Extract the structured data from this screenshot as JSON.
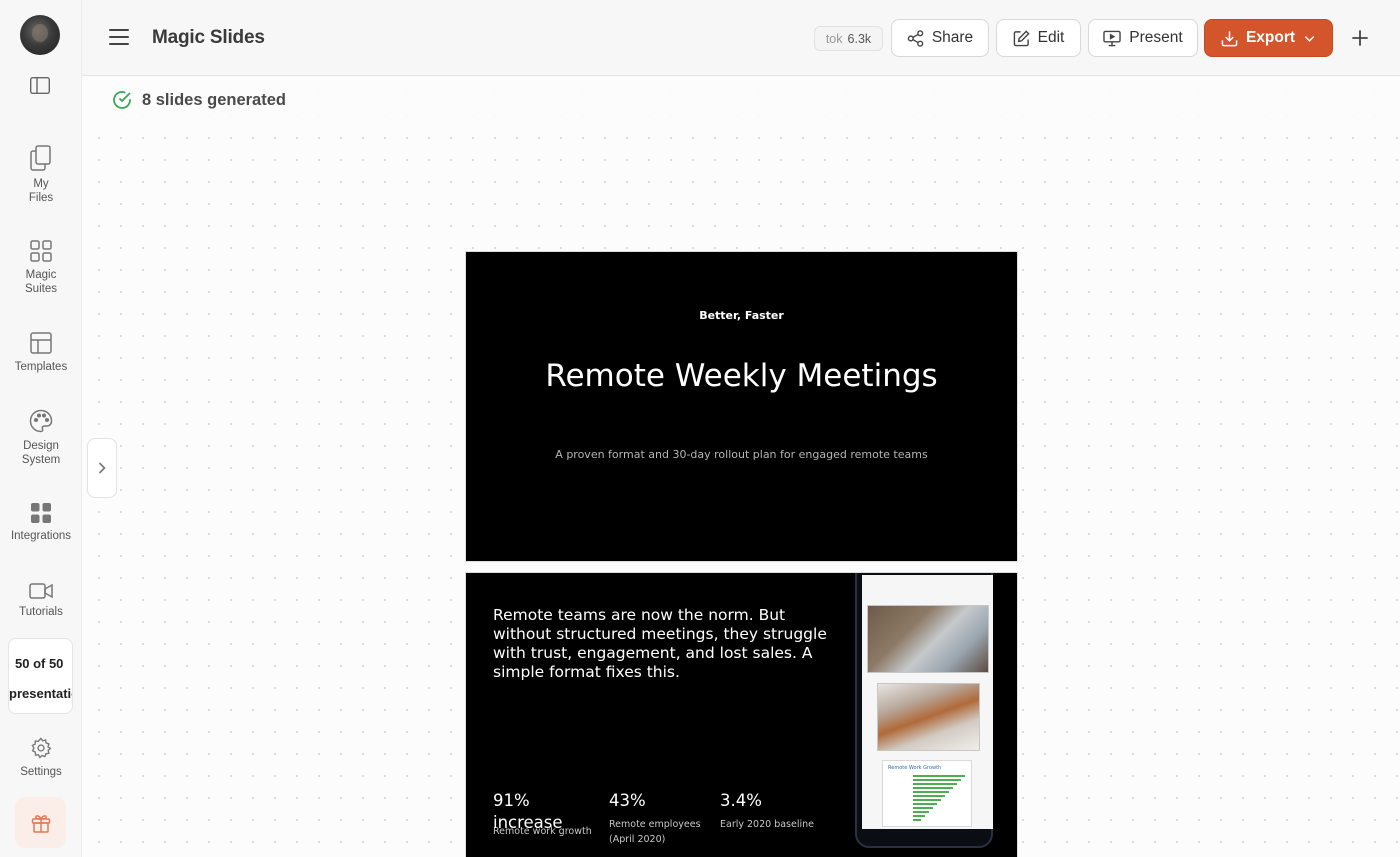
{
  "app": {
    "title": "Magic Slides"
  },
  "sidebar": {
    "items": [
      {
        "label_line1": "My",
        "label_line2": "Files",
        "icon": "files-icon"
      },
      {
        "label_line1": "Magic",
        "label_line2": "Suites",
        "icon": "grid-icon"
      },
      {
        "label_line1": "Templates",
        "label_line2": "",
        "icon": "template-icon"
      },
      {
        "label_line1": "Design",
        "label_line2": "System",
        "icon": "palette-icon"
      },
      {
        "label_line1": "Integrations",
        "label_line2": "",
        "icon": "integrations-icon"
      },
      {
        "label_line1": "Tutorials",
        "label_line2": "",
        "icon": "video-icon"
      },
      {
        "label_line1": "Settings",
        "label_line2": "",
        "icon": "gear-icon"
      }
    ],
    "quota": {
      "count": "50 of 50",
      "unit": "presentations"
    }
  },
  "header": {
    "tok_label": "tok",
    "tok_value": "6.3k",
    "share_label": "Share",
    "edit_label": "Edit",
    "present_label": "Present",
    "export_label": "Export",
    "accent_color": "#d4552c"
  },
  "status": {
    "text": "8 slides generated",
    "color": "#3aa65a"
  },
  "slides": [
    {
      "kicker": "Better, Faster",
      "title": "Remote Weekly Meetings",
      "subtitle": "A proven format and 30-day rollout plan for engaged remote teams"
    },
    {
      "body": "Remote teams are now the norm. But without structured meetings, they struggle with trust, engagement, and lost sales. A simple format fixes this.",
      "stats": [
        {
          "value": "91%",
          "extra": "increase",
          "label": "Remote work growth"
        },
        {
          "value": "43%",
          "label": "Remote employees (April 2020)"
        },
        {
          "value": "3.4%",
          "label": "Early 2020 baseline"
        }
      ],
      "doc_title": "Remote Work Growth"
    }
  ]
}
